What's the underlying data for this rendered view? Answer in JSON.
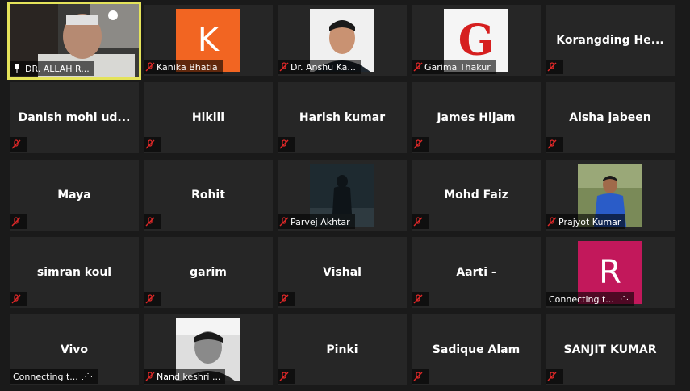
{
  "meeting": {
    "participants": [
      {
        "id": "p0",
        "name": "DR. ALLAH R...",
        "status": "video",
        "pinned": true
      },
      {
        "id": "p1",
        "name": "Kanika Bhatia",
        "avatar_letter": "K",
        "avatar_color": "#f26522",
        "status": "muted"
      },
      {
        "id": "p2",
        "name": "Dr. Anshu Ka...",
        "status": "photo",
        "muted": true
      },
      {
        "id": "p3",
        "name": "Garima Thakur",
        "avatar_letter": "G",
        "status": "muted"
      },
      {
        "id": "p4",
        "name": "Korangding  He...",
        "status": "muted"
      },
      {
        "id": "p5",
        "name": "Danish  mohi  ud...",
        "status": "muted"
      },
      {
        "id": "p6",
        "name": "Hikili",
        "status": "muted"
      },
      {
        "id": "p7",
        "name": "Harish kumar",
        "status": "muted"
      },
      {
        "id": "p8",
        "name": "James Hijam",
        "status": "muted"
      },
      {
        "id": "p9",
        "name": "Aisha jabeen",
        "status": "muted"
      },
      {
        "id": "p10",
        "name": "Maya",
        "status": "muted"
      },
      {
        "id": "p11",
        "name": "Rohit",
        "status": "muted"
      },
      {
        "id": "p12",
        "name": "Parvej Akhtar",
        "status": "photo",
        "muted": true
      },
      {
        "id": "p13",
        "name": "Mohd Faiz",
        "status": "muted"
      },
      {
        "id": "p14",
        "name": "Prajyot Kumar",
        "status": "photo",
        "muted": true
      },
      {
        "id": "p15",
        "name": "simran koul",
        "status": "muted"
      },
      {
        "id": "p16",
        "name": "garim",
        "status": "muted"
      },
      {
        "id": "p17",
        "name": "Vishal",
        "status": "muted"
      },
      {
        "id": "p18",
        "name": "Aarti -",
        "status": "muted"
      },
      {
        "id": "p19",
        "name": "Connecting t...",
        "avatar_letter": "R",
        "avatar_color": "#c2185b",
        "status": "connecting"
      },
      {
        "id": "p20",
        "name": "Vivo",
        "status": "connecting",
        "connecting_label": "Connecting t..."
      },
      {
        "id": "p21",
        "name": "Nand keshri ...",
        "status": "photo",
        "muted": true
      },
      {
        "id": "p22",
        "name": "Pinki",
        "status": "muted"
      },
      {
        "id": "p23",
        "name": "Sadique Alam",
        "status": "muted"
      },
      {
        "id": "p24",
        "name": "SANJIT KUMAR",
        "status": "muted"
      }
    ]
  },
  "colors": {
    "background": "#1a1a1a",
    "tile": "#262626",
    "active_border": "#e4e35a",
    "muted_icon": "#e02828"
  }
}
